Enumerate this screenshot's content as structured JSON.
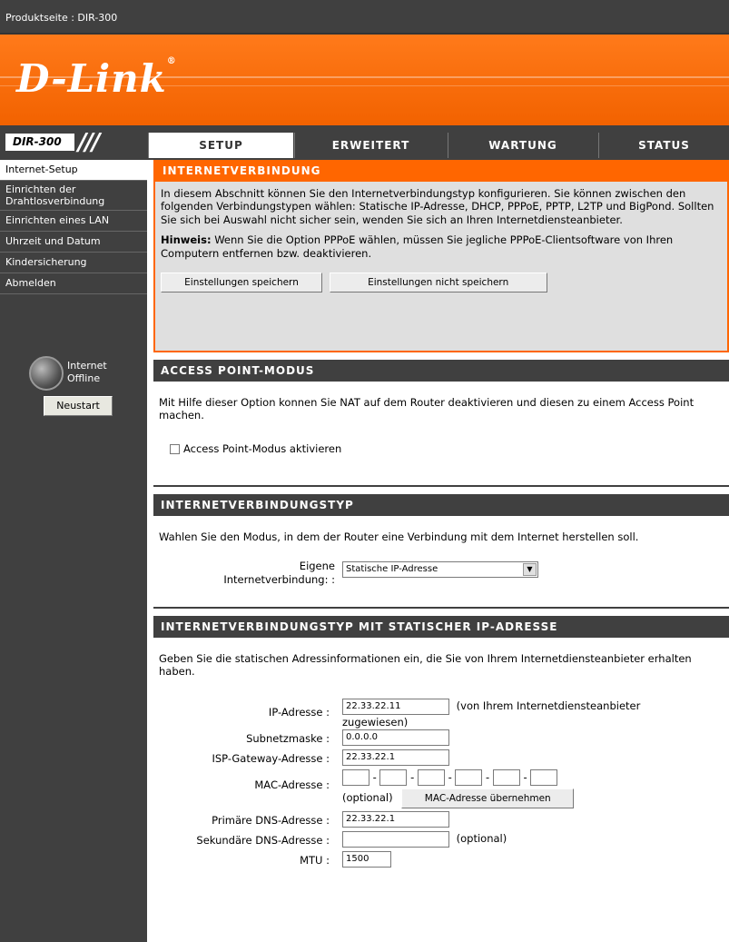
{
  "window": {
    "title": "Produktseite : DIR-300"
  },
  "brand": {
    "logo": "D-Link",
    "model": "DIR-300",
    "accent": "#ff6600",
    "dark": "#404040"
  },
  "tabs": [
    {
      "label": "SETUP",
      "active": true
    },
    {
      "label": "ERWEITERT",
      "active": false
    },
    {
      "label": "WARTUNG",
      "active": false
    },
    {
      "label": "STATUS",
      "active": false
    }
  ],
  "sidebar": {
    "items": [
      {
        "label": "Internet-Setup",
        "active": true
      },
      {
        "label": "Einrichten der Drahtlosverbindung",
        "active": false
      },
      {
        "label": "Einrichten eines LAN",
        "active": false
      },
      {
        "label": "Uhrzeit und Datum",
        "active": false
      },
      {
        "label": "Kindersicherung",
        "active": false
      },
      {
        "label": "Abmelden",
        "active": false
      }
    ],
    "status_line1": "Internet",
    "status_line2": "Offline",
    "reboot_label": "Neustart"
  },
  "internet": {
    "title": "INTERNETVERBINDUNG",
    "intro": "In diesem Abschnitt können Sie den Internetverbindungstyp konfigurieren. Sie können zwischen den folgenden Verbindungstypen wählen: Statische IP-Adresse, DHCP, PPPoE, PPTP, L2TP und BigPond. Sollten Sie sich bei Auswahl nicht sicher sein, wenden Sie sich an Ihren Internetdiensteanbieter.",
    "note_label": "Hinweis:",
    "note_text": " Wenn Sie die Option PPPoE wählen, müssen Sie jegliche PPPoE-Clientsoftware von Ihren Computern entfernen bzw. deaktivieren.",
    "save_label": "Einstellungen speichern",
    "nosave_label": "Einstellungen nicht speichern"
  },
  "ap_mode": {
    "title": "ACCESS POINT-MODUS",
    "desc": "Mit Hilfe dieser Option konnen Sie NAT auf dem Router deaktivieren und diesen zu einem Access Point machen.",
    "checkbox_label": "Access Point-Modus aktivieren",
    "checked": false
  },
  "conn_type": {
    "title": "INTERNETVERBINDUNGSTYP",
    "desc": "Wahlen Sie den Modus, in dem der Router eine Verbindung mit dem Internet herstellen soll.",
    "label_line1": "Eigene",
    "label_line2": "Internetverbindung: :",
    "selected": "Statische IP-Adresse"
  },
  "static_ip": {
    "title": "INTERNETVERBINDUNGSTYP MIT STATISCHER IP-ADRESSE",
    "desc": "Geben Sie die statischen Adressinformationen ein, die Sie von Ihrem Internetdiensteanbieter erhalten haben.",
    "ip_label": "IP-Adresse :",
    "ip_value": "22.33.22.11",
    "ip_hint": "(von Ihrem Internetdiensteanbieter",
    "ip_hint2": "zugewiesen)",
    "mask_label": "Subnetzmaske :",
    "mask_value": "0.0.0.0",
    "gw_label": "ISP-Gateway-Adresse :",
    "gw_value": "22.33.22.1",
    "mac_label": "MAC-Adresse :",
    "mac_optional": "(optional)",
    "mac_clone_label": "MAC-Adresse übernehmen",
    "dns1_label": "Primäre DNS-Adresse :",
    "dns1_value": "22.33.22.1",
    "dns2_label": "Sekundäre DNS-Adresse :",
    "dns2_value": "",
    "dns2_optional": "(optional)",
    "mtu_label": "MTU :",
    "mtu_value": "1500"
  }
}
